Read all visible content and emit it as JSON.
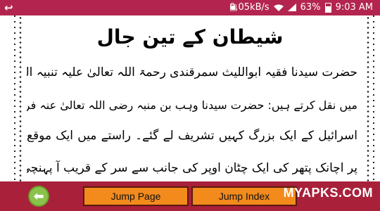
{
  "status_bar": {
    "speed": "0.05kB/s",
    "battery": "63%",
    "time": "9:03 AM",
    "icons": [
      "back-arrow-icon",
      "notification-icon",
      "wifi-icon",
      "signal-icon",
      "battery-icon"
    ]
  },
  "content": {
    "heading": "شیطان کے تین جال",
    "lines": [
      "حضرت سیدنا فقیہ ابواللیث سمرقندی رحمۃ اللہ تعالیٰ علیہ تنبیہ الغافلین",
      "میں نقل کرتے ہیں: حضرت سیدنا وہب بن منبہ رضی اللہ تعالیٰ عنہ فرماتے ہیں: بنی",
      "اسرائیل کے ایک بزرگ کہیں تشریف لے گئے۔ راستے میں ایک موقع",
      "پر اچانک پتھر کی ایک چٹان اوپر کی جانب سے سر کے قریب آ پہنچی، انہوں"
    ]
  },
  "bottom_bar": {
    "back_icon": "arrow-left-icon",
    "jump_page_label": "Jump Page",
    "jump_index_label": "Jump Index",
    "watermark": "MYAPKS.COM"
  },
  "colors": {
    "status_bar": "#b3254f",
    "bottom_bar": "#a8203a",
    "button": "#f28a1c",
    "back_button": "#8bc34a"
  }
}
